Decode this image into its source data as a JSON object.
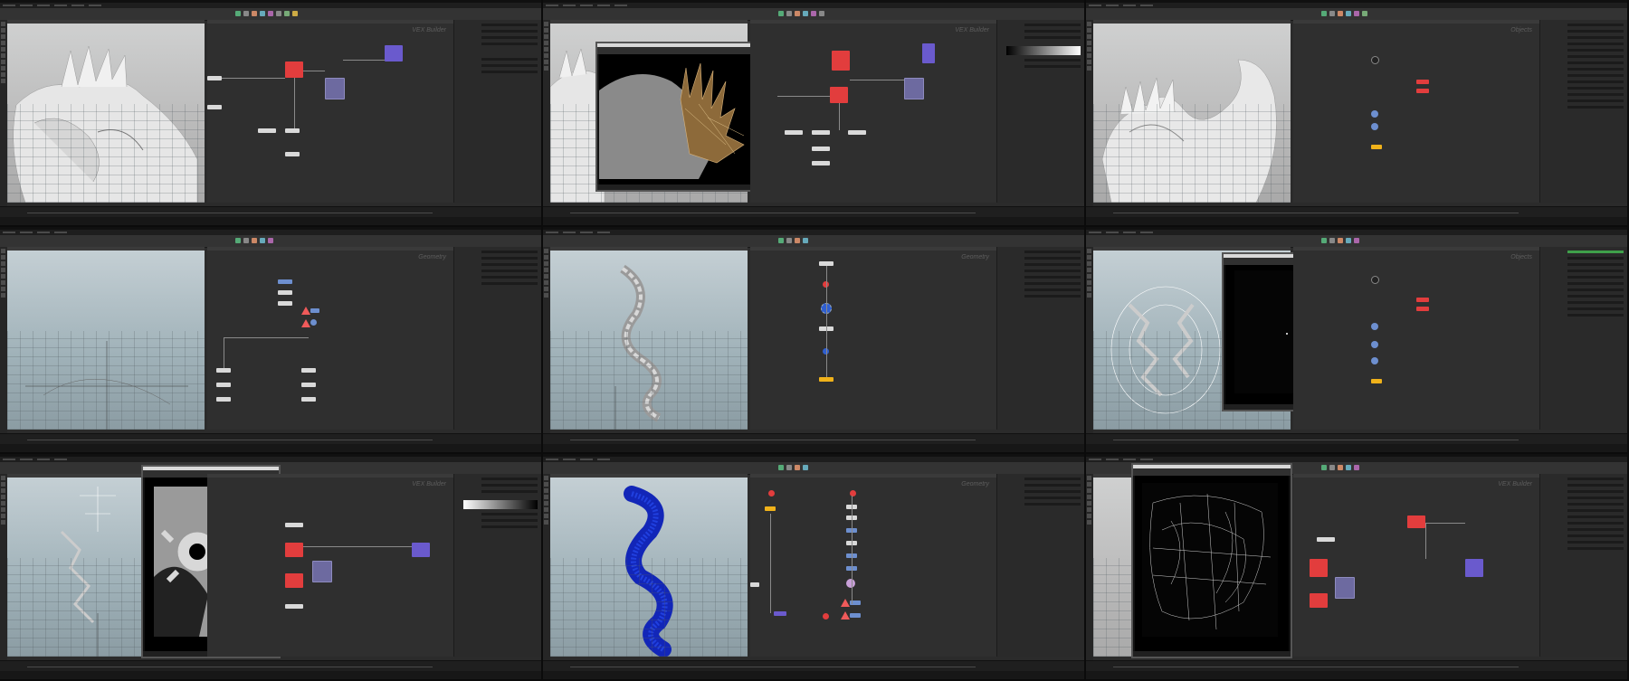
{
  "montage": {
    "layout": "3x3 grid",
    "app_colors": {
      "background": "#2b2b2b",
      "node_red": "#e23d3d",
      "node_blue": "#6d8fcf",
      "node_yellow": "#f0b21a",
      "node_purple": "#6a5acd"
    }
  },
  "frames": [
    {
      "id": 1,
      "context_label": "VEX Builder",
      "viewport": "grey dragon with spines",
      "overlay": null
    },
    {
      "id": 2,
      "context_label": "VEX Builder",
      "viewport": "grey dragon",
      "overlay": "render view with brown spikes"
    },
    {
      "id": 3,
      "context_label": "Objects",
      "viewport": "grey dragon side view",
      "overlay": null
    },
    {
      "id": 4,
      "context_label": "Geometry",
      "viewport": "empty grid",
      "overlay": null
    },
    {
      "id": 5,
      "context_label": "Geometry",
      "viewport": "twisting spine column",
      "overlay": null
    },
    {
      "id": 6,
      "context_label": "Objects",
      "viewport": "wireframe cage with dragons",
      "overlay": "black render window"
    },
    {
      "id": 7,
      "context_label": "VEX Builder",
      "viewport": "wireframe tree",
      "overlay": "grey cog mask render"
    },
    {
      "id": 8,
      "context_label": "Geometry",
      "viewport": "blue point cloud spiral",
      "overlay": null
    },
    {
      "id": 9,
      "context_label": "VEX Builder",
      "viewport": "wireframe",
      "overlay": "white-on-black wireframe render"
    }
  ],
  "icons": [
    "menu-icon",
    "render-icon",
    "play-icon",
    "node-icon",
    "warning-icon"
  ]
}
